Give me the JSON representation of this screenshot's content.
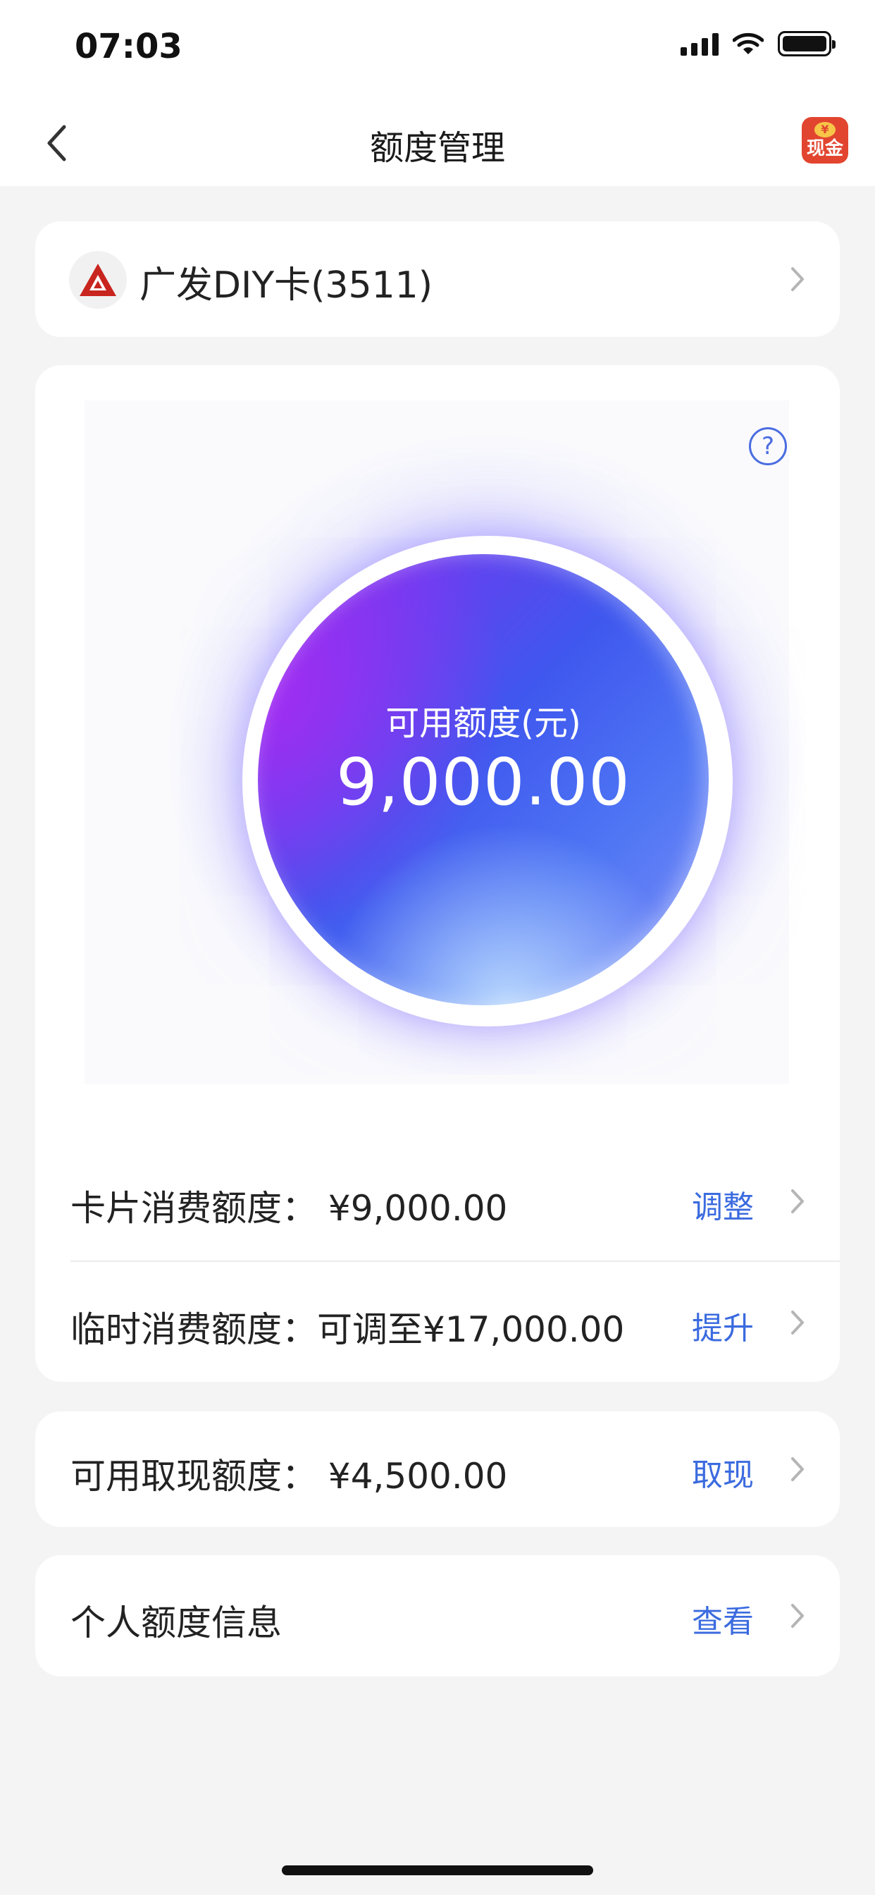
{
  "status": {
    "time": "07:03"
  },
  "nav": {
    "title": "额度管理",
    "cash_badge": "现金",
    "coin": "¥"
  },
  "card": {
    "name": "广发DIY卡(3511)"
  },
  "limit": {
    "label": "可用额度(元)",
    "value": "9,000.00",
    "help": "?"
  },
  "rows": {
    "card_spend": {
      "label": "卡片消费额度：  ¥9,000.00",
      "action": "调整"
    },
    "temp_spend": {
      "label": "临时消费额度：可调至¥17,000.00",
      "action": "提升"
    },
    "cash": {
      "label": "可用取现额度：  ¥4,500.00",
      "action": "取现"
    },
    "info": {
      "label": "个人额度信息",
      "action": "查看"
    }
  },
  "colors": {
    "accent": "#3b6bdf",
    "bank_red": "#c8251e",
    "badge": "#e2452f"
  }
}
